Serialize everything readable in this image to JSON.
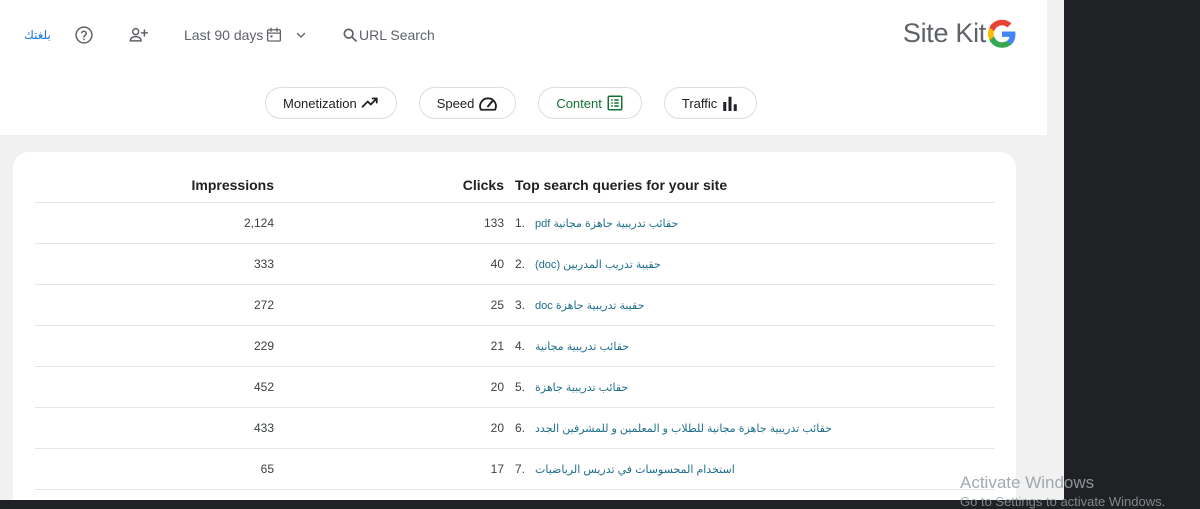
{
  "header": {
    "language_link": "بلغتك",
    "date_range": "Last 90 days",
    "url_search_label": "URL Search",
    "logo_text": "Site Kit"
  },
  "tabs": [
    {
      "label": "Monetization",
      "icon": "trending-up-icon"
    },
    {
      "label": "Speed",
      "icon": "speedometer-icon"
    },
    {
      "label": "Content",
      "icon": "list-icon",
      "active": true
    },
    {
      "label": "Traffic",
      "icon": "bar-chart-icon"
    }
  ],
  "table": {
    "headers": {
      "impressions": "Impressions",
      "clicks": "Clicks",
      "query": "Top search queries for your site"
    },
    "rows": [
      {
        "impressions": "2,124",
        "clicks": "133",
        "num": "1.",
        "query": "حقائب تدريبية جاهزة مجانية pdf"
      },
      {
        "impressions": "333",
        "clicks": "40",
        "num": "2.",
        "query": "حقيبة تدريب المدربين (doc)"
      },
      {
        "impressions": "272",
        "clicks": "25",
        "num": "3.",
        "query": "حقيبة تدريبية جاهزة doc"
      },
      {
        "impressions": "229",
        "clicks": "21",
        "num": "4.",
        "query": "حقائب تدريبية مجانية"
      },
      {
        "impressions": "452",
        "clicks": "20",
        "num": "5.",
        "query": "حقائب تدريبية جاهزة"
      },
      {
        "impressions": "433",
        "clicks": "20",
        "num": "6.",
        "query": "حقائب تدريبية جاهزة مجانية للطلاب و المعلمين و للمشرفين الجدد"
      },
      {
        "impressions": "65",
        "clicks": "17",
        "num": "7.",
        "query": "استخدام المحسوسات في تدريس الرياضيات"
      }
    ]
  },
  "watermark": {
    "title": "Activate Windows",
    "subtitle": "Go to Settings to activate Windows."
  },
  "colors": {
    "link": "#1e6e8c",
    "accent_green": "#137333",
    "google_blue": "#4285f4",
    "google_red": "#ea4335",
    "google_yellow": "#fbbc05",
    "google_green": "#34a853"
  }
}
